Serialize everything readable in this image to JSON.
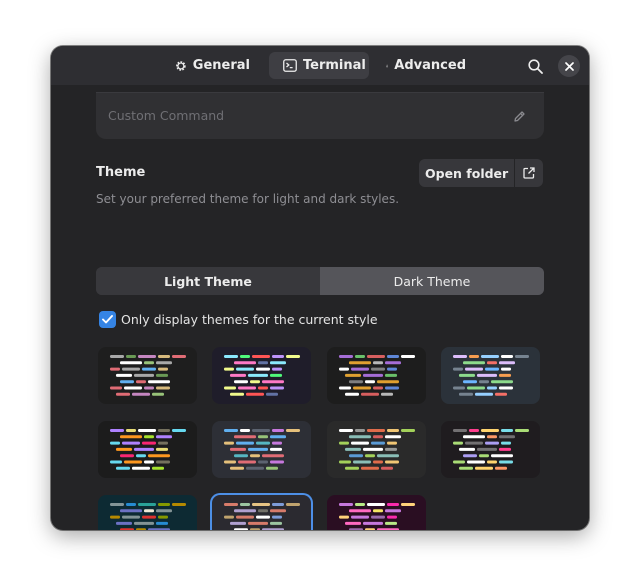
{
  "header": {
    "tabs": [
      {
        "label": "General",
        "icon": "gear-icon"
      },
      {
        "label": "Terminal",
        "icon": "terminal-icon",
        "active": true
      },
      {
        "label": "Advanced",
        "icon": "flask-icon"
      }
    ]
  },
  "command": {
    "label": "Custom Command",
    "icon": "pencil-icon"
  },
  "theme": {
    "title": "Theme",
    "subtitle": "Set your preferred theme for light and dark styles.",
    "open_folder": "Open folder",
    "segments": {
      "light": "Light Theme",
      "dark": "Dark Theme",
      "selected": "dark"
    },
    "only_current_label": "Only display themes for the current style",
    "only_current_checked": true
  },
  "theme_cards": [
    {
      "bg": "#1e1e1e",
      "colors": [
        "#a8a8a8",
        "#6a9955",
        "#c586c0",
        "#d7ba7d",
        "#e06c75",
        "#61afef",
        "#98c379",
        "#ffffff"
      ]
    },
    {
      "bg": "#1f1d2a",
      "colors": [
        "#ff79c6",
        "#8be9fd",
        "#50fa7b",
        "#ff5555",
        "#bd93f9",
        "#f1fa8c",
        "#ffffff",
        "#6272a4"
      ]
    },
    {
      "bg": "#1d1d1d",
      "colors": [
        "#b8b8b8",
        "#e0a030",
        "#a56dd6",
        "#6ac06a",
        "#d75f5f",
        "#5f87d7",
        "#ffffff",
        "#808080"
      ]
    },
    {
      "bg": "#2b323a",
      "colors": [
        "#6cb6ff",
        "#f47067",
        "#8ddb8c",
        "#dcbdfb",
        "#f69d50",
        "#96d0ff",
        "#ffffff",
        "#768390"
      ]
    },
    {
      "bg": "#1c1c1c",
      "colors": [
        "#66d9ef",
        "#f92672",
        "#a6e22e",
        "#fd971f",
        "#ae81ff",
        "#e6db74",
        "#ffffff",
        "#75715e"
      ]
    },
    {
      "bg": "#2d2f36",
      "colors": [
        "#c678dd",
        "#e5c07b",
        "#56b6c2",
        "#98c379",
        "#e06c75",
        "#61afef",
        "#ffffff",
        "#5c6370"
      ]
    },
    {
      "bg": "#2a2a2a",
      "colors": [
        "#e06c4b",
        "#f0c674",
        "#a3d15a",
        "#5b9bd5",
        "#d65d5d",
        "#8abeb7",
        "#ffffff",
        "#969896"
      ]
    },
    {
      "bg": "#1f1c1f",
      "colors": [
        "#ff3e8e",
        "#ffd36e",
        "#78dce8",
        "#a9dc76",
        "#ab9df2",
        "#fc9867",
        "#ffffff",
        "#727072"
      ]
    },
    {
      "bg": "#0d2a33",
      "colors": [
        "#839496",
        "#268bd2",
        "#2aa198",
        "#859900",
        "#b58900",
        "#dc322f",
        "#eee8d5",
        "#6c71c4"
      ]
    },
    {
      "bg": "#2b2a30",
      "colors": [
        "#b0a0d0",
        "#d77b6a",
        "#9cc5a1",
        "#e6c384",
        "#7e9cd8",
        "#c0a36e",
        "#ffffff",
        "#727169"
      ],
      "selected": true
    },
    {
      "bg": "#2a0e22",
      "colors": [
        "#f5e663",
        "#ff6ac1",
        "#c678dd",
        "#b8e986",
        "#ffffff",
        "#f92aad",
        "#ffd27a",
        "#9a6aab"
      ]
    }
  ]
}
